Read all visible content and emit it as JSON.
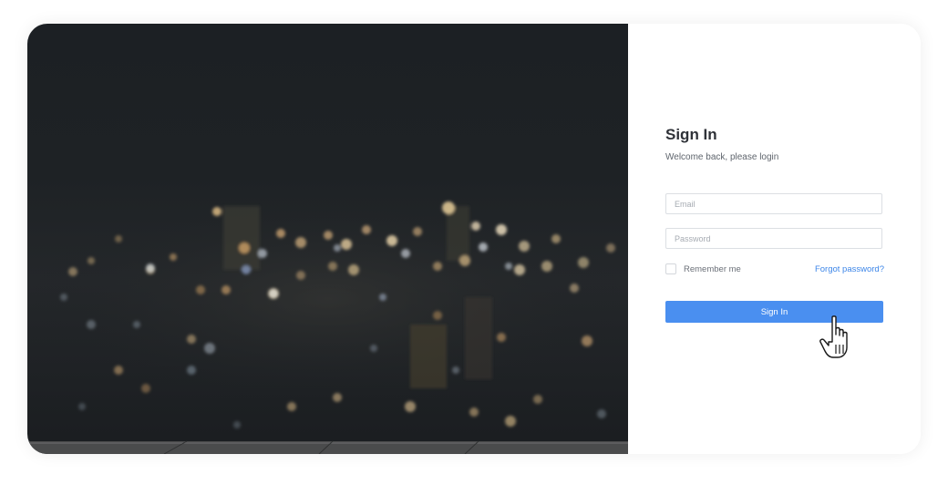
{
  "sign_in": {
    "title": "Sign In",
    "subtitle": "Welcome back, please login",
    "email_placeholder": "Email",
    "password_placeholder": "Password",
    "remember_label": "Remember me",
    "forgot_label": "Forgot password?",
    "button_label": "Sign In"
  },
  "background_image": {
    "description_icon": "night-city-bokeh-image"
  },
  "colors": {
    "accent": "#4a8ff0",
    "link": "#3d86e8",
    "title": "#2f3238"
  },
  "cursor": {
    "icon": "hand-pointer-icon"
  }
}
